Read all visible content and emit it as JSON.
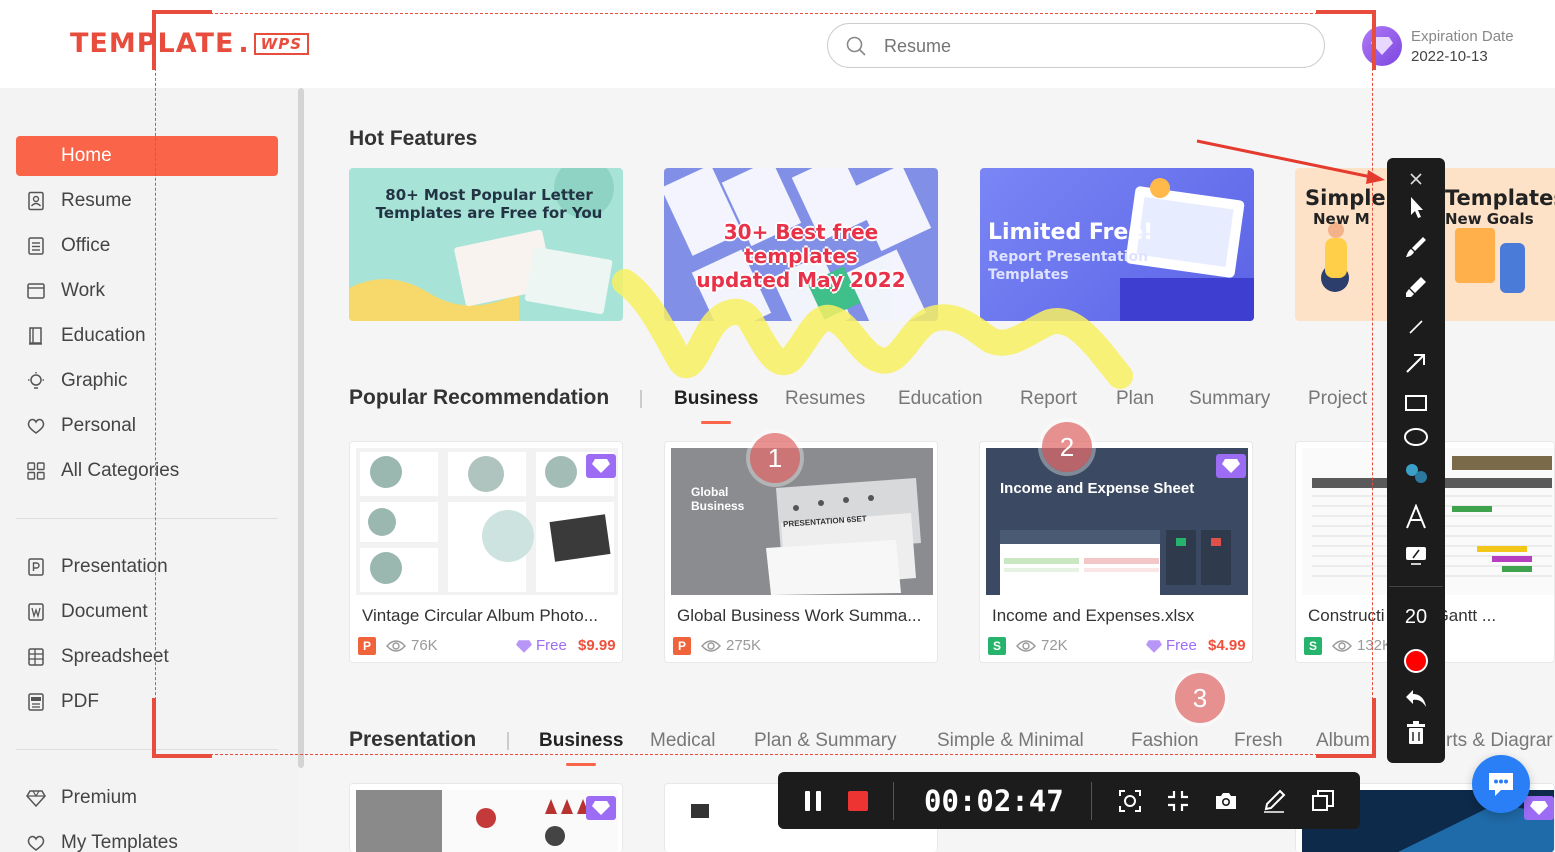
{
  "header": {
    "logo_text": "TEMPLATE",
    "logo_suffix": "WPS",
    "search_placeholder": "Resume",
    "expiration_label": "Expiration Date",
    "expiration_date": "2022-10-13"
  },
  "sidebar": {
    "primary": [
      {
        "label": "Home",
        "icon": "home-icon",
        "active": true
      },
      {
        "label": "Resume",
        "icon": "resume-icon"
      },
      {
        "label": "Office",
        "icon": "office-icon"
      },
      {
        "label": "Work",
        "icon": "work-icon"
      },
      {
        "label": "Education",
        "icon": "education-icon"
      },
      {
        "label": "Graphic",
        "icon": "graphic-icon"
      },
      {
        "label": "Personal",
        "icon": "personal-icon"
      },
      {
        "label": "All Categories",
        "icon": "grid-icon"
      }
    ],
    "file_types": [
      {
        "label": "Presentation",
        "icon": "presentation-icon"
      },
      {
        "label": "Document",
        "icon": "document-icon"
      },
      {
        "label": "Spreadsheet",
        "icon": "spreadsheet-icon"
      },
      {
        "label": "PDF",
        "icon": "pdf-icon"
      }
    ],
    "account": [
      {
        "label": "Premium",
        "icon": "diamond-icon"
      },
      {
        "label": "My Templates",
        "icon": "heart-icon"
      }
    ]
  },
  "hot_features": {
    "title": "Hot Features",
    "banners": [
      {
        "text": "80+ Most Popular Letter Templates are Free for You",
        "line1": "80+ Most Popular Letter",
        "line2": "Templates are Free for You",
        "bg": "#a8e3d7"
      },
      {
        "text": "30+ Best free templates updated May 2022",
        "line1": "30+ Best free templates",
        "line2": "updated May 2022",
        "bg": "#7c8de8"
      },
      {
        "text": "Limited Free! Report Presentation Templates",
        "line1": "Limited Free!",
        "line2": "Report Presentation",
        "line3": "Templates",
        "bg": "#6f7cf0"
      },
      {
        "text": "Simple Templates New Goals",
        "line1a": "Simple",
        "line1b": "Templates",
        "line2a": "New M",
        "line2b": "New Goals",
        "bg": "#fde2c8"
      }
    ]
  },
  "popular": {
    "title": "Popular Recommendation",
    "tabs": [
      "Business",
      "Resumes",
      "Education",
      "Report",
      "Plan",
      "Summary",
      "Project"
    ],
    "active_tab": "Business",
    "cards": [
      {
        "title": "Vintage Circular Album Photo...",
        "type": "P",
        "views": "76K",
        "free": "Free",
        "price": "$9.99",
        "premium": true
      },
      {
        "title": "Global Business Work Summa...",
        "type": "P",
        "views": "275K",
        "thumb_title": "Global Business",
        "thumb_sub": "PRESENTATION 6SET",
        "premium": false
      },
      {
        "title": "Income and Expenses.xlsx",
        "type": "S",
        "views": "72K",
        "free": "Free",
        "price": "$4.99",
        "thumb_title": "Income and Expense Sheet",
        "premium": true
      },
      {
        "title": "Constructi edule Gantt ...",
        "type": "S",
        "views": "132K",
        "premium": false
      }
    ]
  },
  "presentation": {
    "title": "Presentation",
    "tabs": [
      "Business",
      "Medical",
      "Plan & Summary",
      "Simple & Minimal",
      "Fashion",
      "Fresh",
      "Album",
      "rts & Diagrar"
    ],
    "active_tab": "Business"
  },
  "recorder": {
    "timer": "00:02:47",
    "brush_size": "20",
    "markers": [
      "1",
      "2",
      "3"
    ],
    "accent": "#e84c3d"
  }
}
